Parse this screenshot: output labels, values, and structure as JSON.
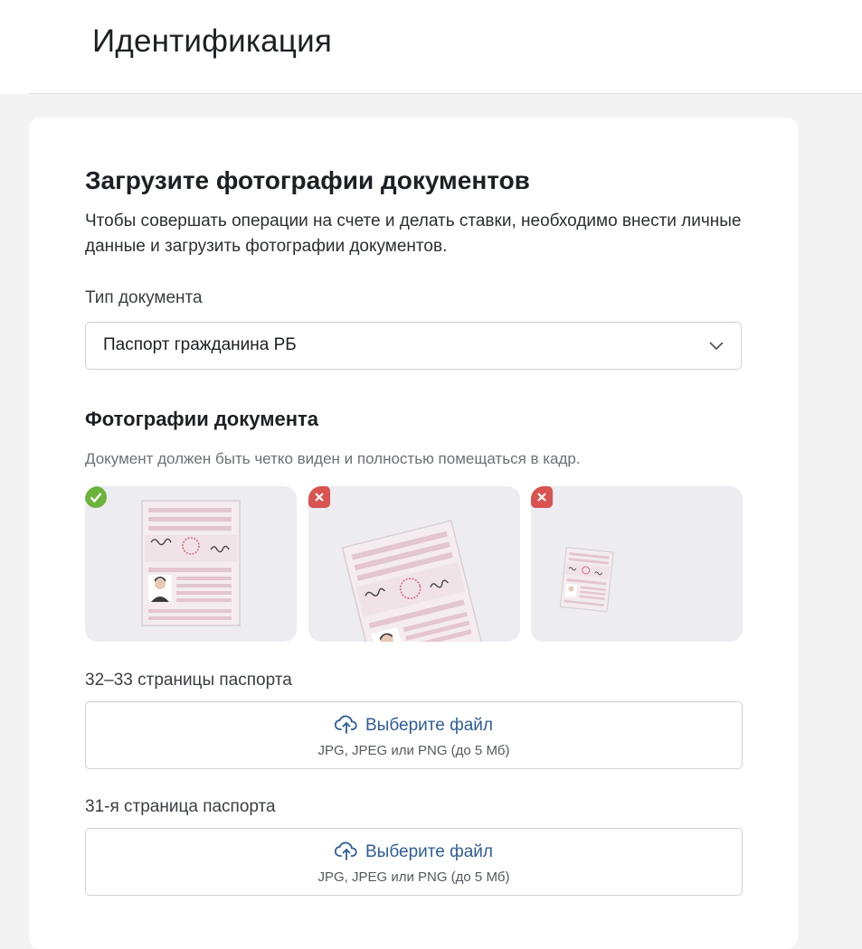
{
  "header": {
    "title": "Идентификация"
  },
  "card": {
    "title": "Загрузите фотографии документов",
    "description": "Чтобы совершать операции на счете и делать ставки, необходимо внести личные данные и загрузить фотографии документов.",
    "doc_type": {
      "label": "Тип документа",
      "selected": "Паспорт гражданина РБ",
      "icon": "chevron-down-icon"
    },
    "photos": {
      "title": "Фотографии документа",
      "hint": "Документ должен быть четко виден и полностью помещаться в кадр.",
      "examples": [
        {
          "status": "correct",
          "badge_icon": "check-icon",
          "badge_color": "#6bb33a"
        },
        {
          "status": "wrong",
          "badge_icon": "cross-icon",
          "badge_color": "#d9534f"
        },
        {
          "status": "wrong",
          "badge_icon": "cross-icon",
          "badge_color": "#d9534f"
        }
      ]
    },
    "uploads": [
      {
        "label": "32–33 страницы паспорта",
        "action": "Выберите файл",
        "hint": "JPG, JPEG или PNG (до 5 Мб)",
        "icon": "upload-cloud-icon"
      },
      {
        "label": "31-я страница паспорта",
        "action": "Выберите файл",
        "hint": "JPG, JPEG или PNG (до 5 Мб)",
        "icon": "upload-cloud-icon"
      }
    ]
  },
  "colors": {
    "link": "#2e5d94",
    "ok": "#6bb33a",
    "error": "#d9534f"
  }
}
